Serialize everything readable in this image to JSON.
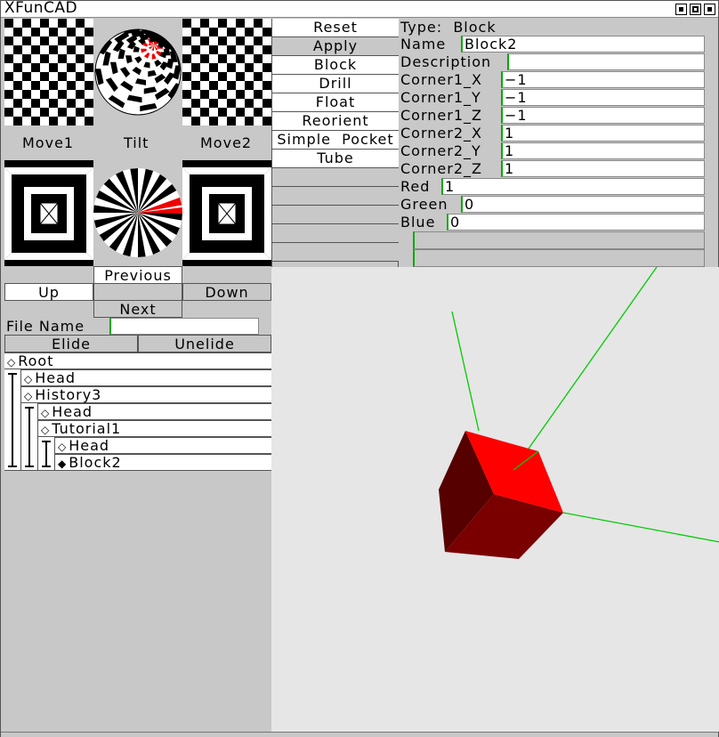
{
  "window": {
    "title": "FunCAD",
    "x_glyph": "X"
  },
  "nav": {
    "move1": "Move1",
    "tilt": "Tilt",
    "move2": "Move2",
    "previous": "Previous",
    "up": "Up",
    "down": "Down",
    "next": "Next"
  },
  "commands": [
    "Reset",
    "Apply",
    "Block",
    "Drill",
    "Float",
    "Reorient",
    "Simple  Pocket",
    "Tube"
  ],
  "props": {
    "type_label": "Type:",
    "type_value": "Block",
    "fields": [
      {
        "label": "Name",
        "value": "Block2"
      },
      {
        "label": "Description",
        "value": ""
      },
      {
        "label": "Corner1_X",
        "value": "−1"
      },
      {
        "label": "Corner1_Y",
        "value": "−1"
      },
      {
        "label": "Corner1_Z",
        "value": "−1"
      },
      {
        "label": "Corner2_X",
        "value": "1"
      },
      {
        "label": "Corner2_Y",
        "value": "1"
      },
      {
        "label": "Corner2_Z",
        "value": "1"
      },
      {
        "label": "Red",
        "value": "1"
      },
      {
        "label": "Green",
        "value": "0"
      },
      {
        "label": "Blue",
        "value": "0"
      }
    ]
  },
  "file": {
    "label": "File  Name",
    "value": ""
  },
  "elide": {
    "elide": "Elide",
    "unelide": "Unelide"
  },
  "tree": [
    {
      "label": "Root",
      "depth": 0,
      "selected": false
    },
    {
      "label": "Head",
      "depth": 1,
      "selected": false
    },
    {
      "label": "History3",
      "depth": 1,
      "selected": false
    },
    {
      "label": "Head",
      "depth": 2,
      "selected": false
    },
    {
      "label": "Tutorial1",
      "depth": 2,
      "selected": false
    },
    {
      "label": "Head",
      "depth": 3,
      "selected": false
    },
    {
      "label": "Block2",
      "depth": 3,
      "selected": true
    }
  ],
  "colors": {
    "cube_top": "#ff0000",
    "cube_right": "#7a0000",
    "cube_left": "#560000",
    "axis": "#00cc00",
    "viewport_bg": "#e6e6e6"
  }
}
